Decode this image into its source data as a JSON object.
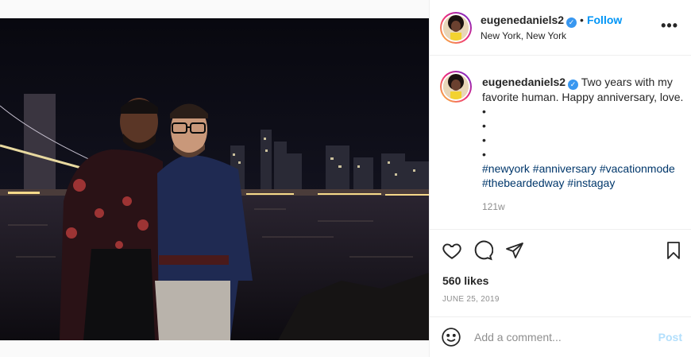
{
  "post": {
    "username": "eugenedaniels2",
    "verified_mark": "✓",
    "separator": "•",
    "follow_label": "Follow",
    "location": "New York, New York",
    "more_label": "•••"
  },
  "caption": {
    "text": "Two years with my favorite human. Happy anniversary, love.",
    "bullets": [
      "•",
      "•",
      "•",
      "•"
    ],
    "hashtags_line1": "#newyork #anniversary #vacationmode",
    "hashtags_line2": "#thebeardedway #instagay",
    "time_ago": "121w"
  },
  "actions": {
    "icons": [
      "heart-icon",
      "comment-icon",
      "share-icon",
      "bookmark-icon"
    ],
    "likes": "560 likes",
    "date": "JUNE 25, 2019"
  },
  "comment_box": {
    "placeholder": "Add a comment...",
    "post_label": "Post",
    "emoji_icon": "smiley-icon"
  },
  "colors": {
    "accent": "#0095f6",
    "post_disabled": "#b2dffc",
    "hashtag": "#00376b",
    "muted": "#8e8e8e"
  }
}
